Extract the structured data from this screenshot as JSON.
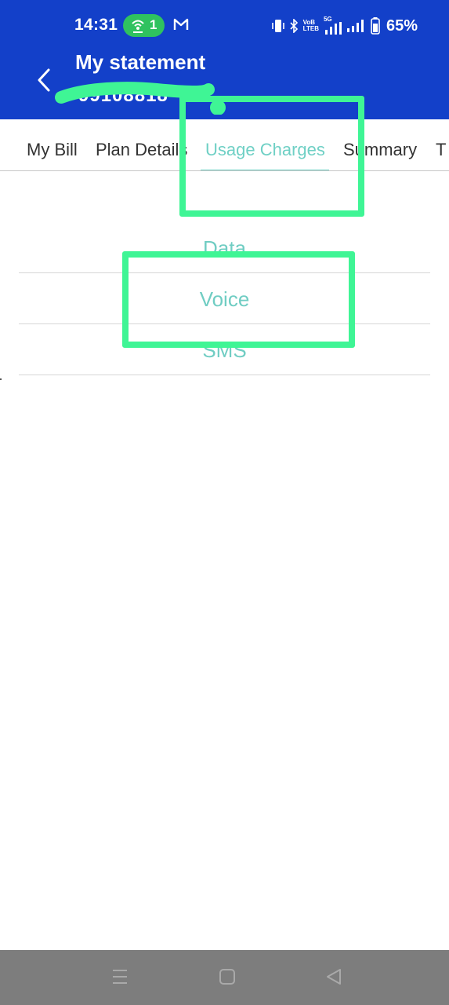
{
  "status_bar": {
    "time": "14:31",
    "hotspot_count": "1",
    "network": "5G",
    "volte_line1": "VoB",
    "volte_line2": "LTEB",
    "battery": "65%"
  },
  "header": {
    "title": "My statement",
    "masked_number": "99108818",
    "background": "#1340c9"
  },
  "tabs": [
    {
      "label": "My Bill",
      "active": false
    },
    {
      "label": "Plan Details",
      "active": false
    },
    {
      "label": "Usage Charges",
      "active": true
    },
    {
      "label": "Summary",
      "active": false
    },
    {
      "label": "T",
      "active": false
    }
  ],
  "usage_items": [
    {
      "label": "Data"
    },
    {
      "label": "Voice"
    },
    {
      "label": "SMS"
    }
  ],
  "colors": {
    "accent": "#6fd0c5",
    "highlight": "#3ff595",
    "navbar": "#7d7d7d"
  },
  "navbar": {
    "icons": [
      "menu-icon",
      "home-icon",
      "back-triangle-icon"
    ]
  }
}
